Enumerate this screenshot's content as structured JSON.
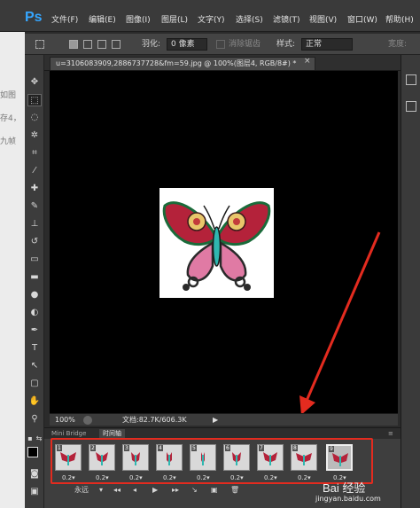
{
  "app": {
    "logo": "Ps",
    "menu": [
      "文件(F)",
      "编辑(E)",
      "图像(I)",
      "图层(L)",
      "文字(Y)",
      "选择(S)",
      "滤镜(T)",
      "视图(V)",
      "窗口(W)",
      "帮助(H)"
    ]
  },
  "options": {
    "feather_label": "羽化:",
    "feather_value": "0 像素",
    "antialias_label": "消除锯齿",
    "style_label": "样式:",
    "style_value": "正常",
    "width_label": "宽度:"
  },
  "background_text": [
    "如图",
    "存4，",
    "九帧"
  ],
  "document": {
    "tab_title": "u=3106083909,2886737728&fm=59.jpg @ 100%(图层4, RGB/8#) *",
    "close_glyph": "×"
  },
  "status": {
    "zoom": "100%",
    "doc_info": "文档:82.7K/606.3K"
  },
  "panel": {
    "tabs": [
      "Mini Bridge",
      "时间轴"
    ],
    "frames": [
      {
        "num": "1",
        "delay": "0.2▾"
      },
      {
        "num": "2",
        "delay": "0.2▾"
      },
      {
        "num": "3",
        "delay": "0.2▾"
      },
      {
        "num": "4",
        "delay": "0.2▾"
      },
      {
        "num": "5",
        "delay": "0.2▾"
      },
      {
        "num": "6",
        "delay": "0.2▾"
      },
      {
        "num": "7",
        "delay": "0.2▾"
      },
      {
        "num": "8",
        "delay": "0.2▾"
      },
      {
        "num": "9",
        "delay": "0.2▾"
      }
    ],
    "loop": "永远",
    "loop_arrow": "▾",
    "controls": [
      "◂◂",
      "◂",
      "▶",
      "▸▸",
      "↘",
      "▣",
      "🗑"
    ]
  },
  "watermark": {
    "main": "Bai 经验",
    "url": "jingyan.baidu.com"
  },
  "colors": {
    "highlight": "#e32b1f",
    "accent": "#35a6ff"
  }
}
